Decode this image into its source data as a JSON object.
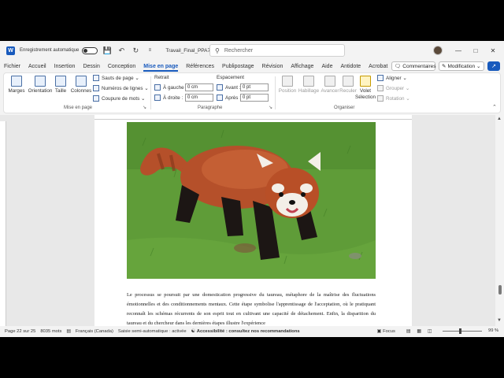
{
  "titlebar": {
    "autosave_label": "Enregistrement automatique",
    "doc_name": "Travail_Final_PPA70... ⌄",
    "search_placeholder": "Rechercher"
  },
  "menu": {
    "tabs": [
      "Fichier",
      "Accueil",
      "Insertion",
      "Dessin",
      "Conception",
      "Mise en page",
      "Références",
      "Publipostage",
      "Révision",
      "Affichage",
      "Aide",
      "Antidote",
      "Acrobat"
    ],
    "active_tab": "Mise en page",
    "comments_label": "Commentaires",
    "edit_mode_label": "Modification ⌄"
  },
  "ribbon": {
    "page_setup": {
      "margins": "Marges",
      "orientation": "Orientation",
      "size": "Taille",
      "columns": "Colonnes",
      "breaks": "Sauts de page ⌄",
      "line_numbers": "Numéros de lignes ⌄",
      "hyphenation": "Coupure de mots ⌄",
      "group_label": "Mise en page"
    },
    "paragraph": {
      "indent_head": "Retrait",
      "left_label": "À gauche :",
      "left_value": "0 cm",
      "right_label": "À droite :",
      "right_value": "0 cm",
      "spacing_head": "Espacement",
      "before_label": "Avant :",
      "before_value": "0 pt",
      "after_label": "Après :",
      "after_value": "0 pt",
      "group_label": "Paragraphe"
    },
    "arrange": {
      "position": "Position",
      "wrap": "Habillage",
      "forward": "Avancer",
      "backward": "Reculer",
      "selection_pane": "Volet Sélection",
      "align": "Aligner ⌄",
      "group": "Grouper ⌄",
      "rotate": "Rotation ⌄",
      "group_label": "Organiser"
    }
  },
  "document": {
    "paragraph_text": "Le processus se poursuit par une domestication progressive du taureau, métaphore de la maîtrise des fluctuations émotionnelles et des conditionnements mentaux. Cette étape symbolise l'apprentissage de l'acceptation, où le pratiquant reconnaît les schémas récurrents de son esprit tout en cultivant une capacité de détachement. Enfin, la disparition du taureau et du chercheur dans les dernières étapes illustre l'expérience"
  },
  "statusbar": {
    "page": "Page 22 sur 25",
    "words": "8035 mots",
    "language": "Français (Canada)",
    "autocomplete": "Saisie semi-automatique : activée",
    "accessibility": "Accessibilité : consultez nos recommandations",
    "focus": "Focus",
    "zoom": "99 %"
  },
  "colors": {
    "accent": "#185abd",
    "panda_fur": "#b5502a",
    "grass": "#5a9a35"
  }
}
